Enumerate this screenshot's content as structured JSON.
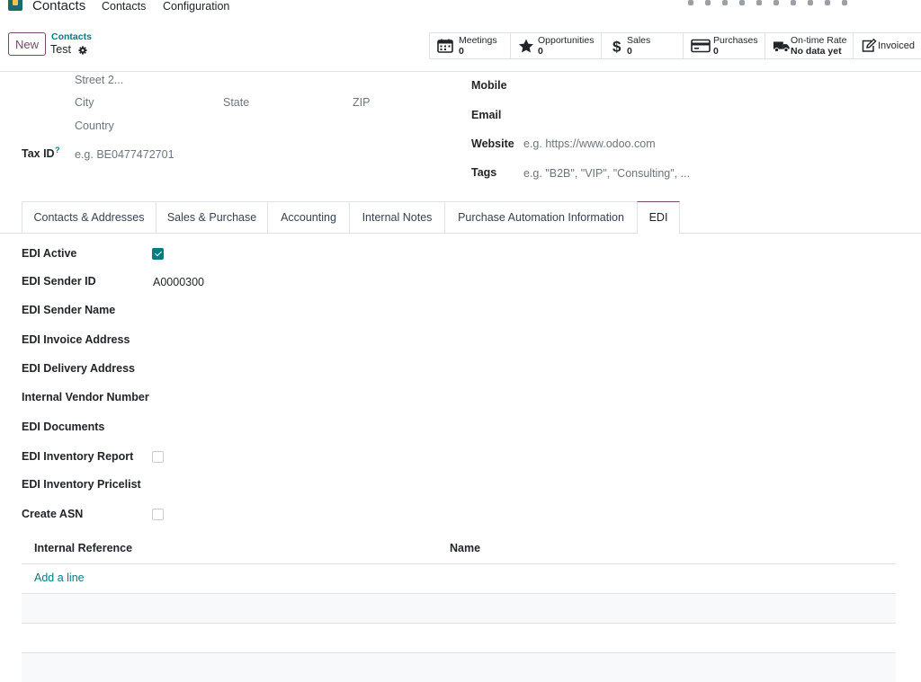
{
  "topnav": {
    "app_title": "Contacts",
    "menu": [
      "Contacts",
      "Configuration"
    ]
  },
  "control_panel": {
    "new_label": "New",
    "breadcrumb_parent": "Contacts",
    "breadcrumb_current": "Test"
  },
  "smart_buttons": [
    {
      "label": "Meetings",
      "value": "0",
      "icon": "calendar-icon"
    },
    {
      "label": "Opportunities",
      "value": "0",
      "icon": "star-icon"
    },
    {
      "label": "Sales",
      "value": "0",
      "icon": "dollar-icon"
    },
    {
      "label": "Purchases",
      "value": "0",
      "icon": "credit-card-icon"
    },
    {
      "label": "On-time Rate",
      "value": "No data yet",
      "icon": "truck-icon"
    },
    {
      "label": "Invoiced",
      "value": "",
      "icon": "pencil-square-icon"
    }
  ],
  "address": {
    "street2_placeholder": "Street 2...",
    "city_placeholder": "City",
    "state_placeholder": "State",
    "zip_placeholder": "ZIP",
    "country_placeholder": "Country",
    "tax_id_label": "Tax ID",
    "tax_id_tooltip": "?",
    "tax_id_placeholder": "e.g. BE0477472701"
  },
  "contact_info": {
    "mobile_label": "Mobile",
    "email_label": "Email",
    "website_label": "Website",
    "website_placeholder": "e.g. https://www.odoo.com",
    "tags_label": "Tags",
    "tags_placeholder": "e.g. \"B2B\", \"VIP\", \"Consulting\", ..."
  },
  "tabs": [
    {
      "label": "Contacts & Addresses",
      "active": false
    },
    {
      "label": "Sales & Purchase",
      "active": false
    },
    {
      "label": "Accounting",
      "active": false
    },
    {
      "label": "Internal Notes",
      "active": false
    },
    {
      "label": "Purchase Automation Information",
      "active": false
    },
    {
      "label": "EDI",
      "active": true
    }
  ],
  "edi": {
    "edi_active_label": "EDI Active",
    "edi_active_checked": true,
    "sender_id_label": "EDI Sender ID",
    "sender_id_value": "A0000300",
    "sender_name_label": "EDI Sender Name",
    "invoice_address_label": "EDI Invoice Address",
    "delivery_address_label": "EDI Delivery Address",
    "vendor_number_label": "Internal Vendor Number",
    "documents_label": "EDI Documents",
    "inventory_report_label": "EDI Inventory Report",
    "inventory_report_checked": false,
    "inventory_pricelist_label": "EDI Inventory Pricelist",
    "create_asn_label": "Create ASN",
    "create_asn_checked": false
  },
  "list": {
    "columns": [
      "Internal Reference",
      "Name"
    ],
    "add_line_label": "Add a line"
  },
  "colors": {
    "brand": "#714b67",
    "accent": "#017e84"
  }
}
